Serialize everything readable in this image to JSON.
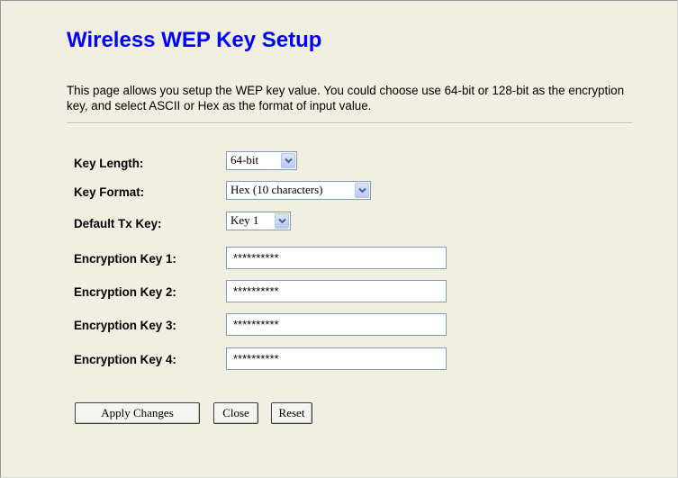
{
  "header": {
    "title": "Wireless WEP Key Setup",
    "description": "This page allows you setup the WEP key value. You could choose use 64-bit or 128-bit as the encryption key, and select ASCII or Hex as the format of input value."
  },
  "form": {
    "key_length": {
      "label": "Key Length:",
      "value": "64-bit"
    },
    "key_format": {
      "label": "Key Format:",
      "value": "Hex (10 characters)"
    },
    "default_tx_key": {
      "label": "Default Tx Key:",
      "value": "Key 1"
    },
    "encryption_keys": [
      {
        "label": "Encryption Key 1:",
        "value": "**********"
      },
      {
        "label": "Encryption Key 2:",
        "value": "**********"
      },
      {
        "label": "Encryption Key 3:",
        "value": "**********"
      },
      {
        "label": "Encryption Key 4:",
        "value": "**********"
      }
    ]
  },
  "buttons": {
    "apply": "Apply Changes",
    "close": "Close",
    "reset": "Reset"
  },
  "icons": {
    "dropdown": "chevron-down-icon"
  },
  "colors": {
    "page_background": "#f1efe2",
    "title": "#0000ff",
    "input_border": "#7f9db9"
  }
}
